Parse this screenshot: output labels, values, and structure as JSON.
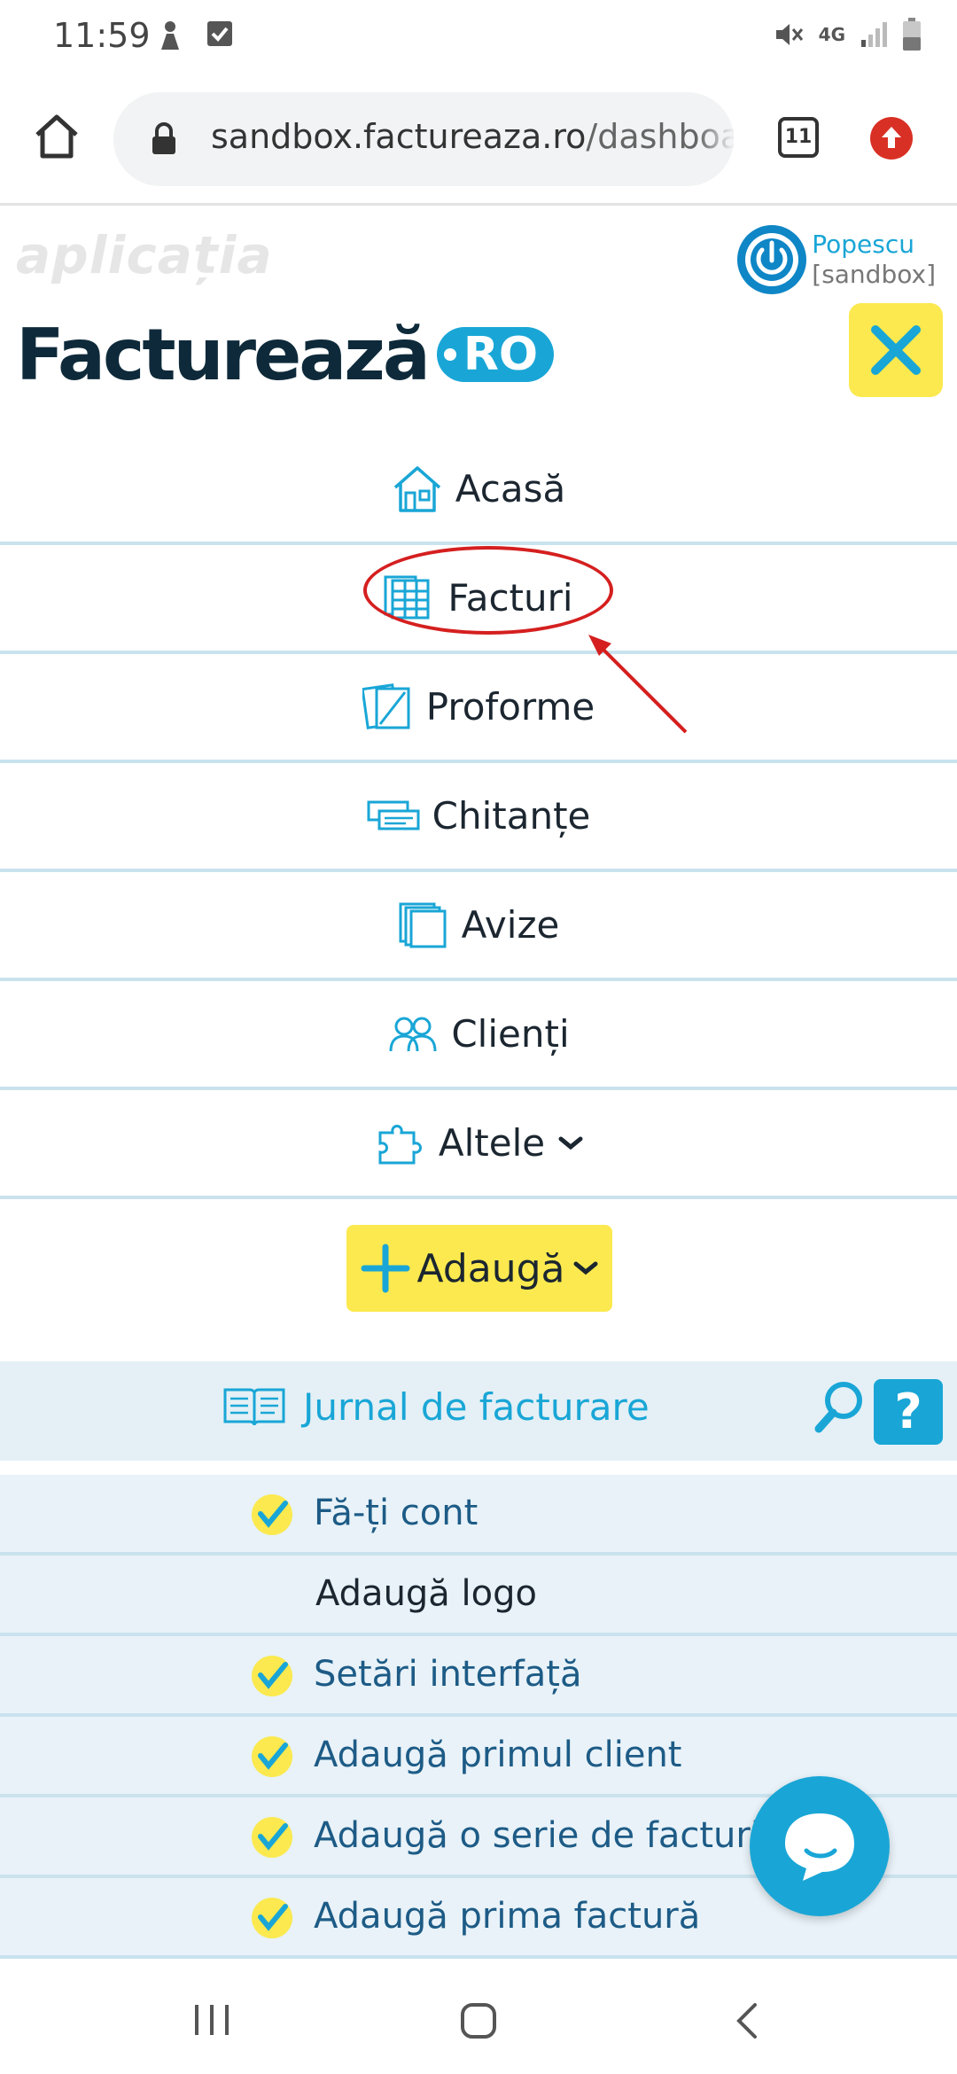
{
  "status_bar": {
    "time": "11:59",
    "network": "4G"
  },
  "browser": {
    "url_host": "sandbox.factureaza.ro",
    "url_path": "/dashboard",
    "tab_count": "11"
  },
  "header": {
    "app_label": "aplicația",
    "brand_name": "Facturează",
    "brand_badge": "RO",
    "user_name": "Popescu",
    "user_context": "[sandbox]"
  },
  "menu": {
    "items": [
      {
        "label": "Acasă",
        "icon": "house-icon"
      },
      {
        "label": "Facturi",
        "icon": "invoices-icon"
      },
      {
        "label": "Proforme",
        "icon": "proforma-icon"
      },
      {
        "label": "Chitanțe",
        "icon": "receipts-icon"
      },
      {
        "label": "Avize",
        "icon": "notices-icon"
      },
      {
        "label": "Clienți",
        "icon": "clients-icon"
      },
      {
        "label": "Altele",
        "icon": "puzzle-icon"
      }
    ],
    "add_label": "Adaugă"
  },
  "journal": {
    "title": "Jurnal de facturare",
    "help_label": "?"
  },
  "checklist": [
    {
      "label": "Fă-ți cont",
      "done": true
    },
    {
      "label": "Adaugă logo",
      "done": false
    },
    {
      "label": "Setări interfață",
      "done": true
    },
    {
      "label": "Adaugă primul client",
      "done": true
    },
    {
      "label": "Adaugă o serie de facturi",
      "done": true
    },
    {
      "label": "Adaugă prima factură",
      "done": true
    }
  ],
  "colors": {
    "accent": "#19a6d6",
    "highlight_yellow": "#fbe94f",
    "annotation_red": "#d51f1f",
    "brand_dark": "#0e2a3a"
  }
}
